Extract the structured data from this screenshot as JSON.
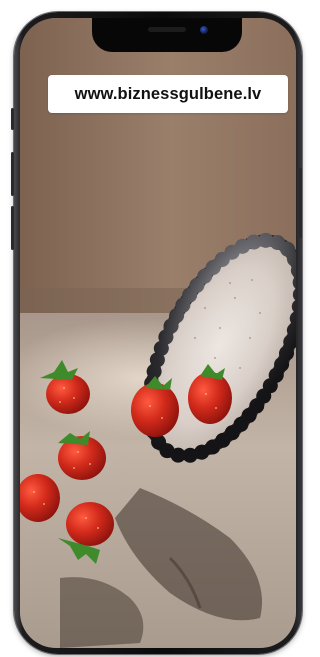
{
  "banner": {
    "url_text": "www.biznessgulbene.lv"
  },
  "photo": {
    "subject": "glass bowl with beaded black rim and strawberries on stone surface",
    "colors": {
      "wall": "#8a6e5c",
      "table": "#b7aa9b",
      "strawberry": "#c9281c",
      "beads": "#2a2a2c"
    }
  },
  "device": {
    "model_hint": "iPhone X style frame",
    "frame_color": "#0b0b0c"
  }
}
